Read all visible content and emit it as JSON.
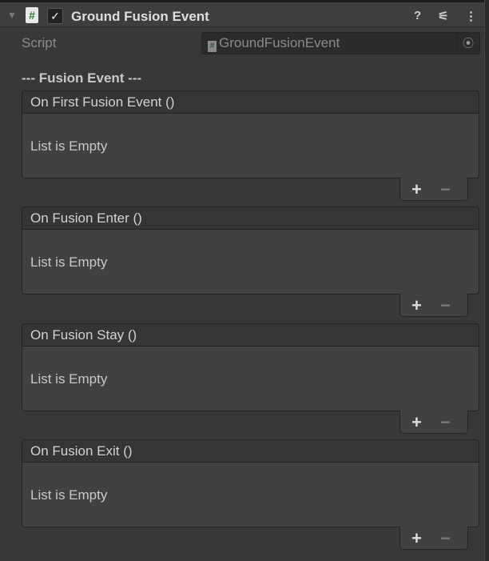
{
  "component": {
    "title": "Ground Fusion Event",
    "enabled": true,
    "icons": [
      "foldout-arrow-icon",
      "script-icon",
      "help-icon",
      "presets-icon",
      "more-icon"
    ]
  },
  "script": {
    "label": "Script",
    "value": "GroundFusionEvent"
  },
  "section_header": "--- Fusion Event ---",
  "events": [
    {
      "name": "On First Fusion Event ()",
      "empty_text": "List is Empty"
    },
    {
      "name": "On Fusion Enter ()",
      "empty_text": "List is Empty"
    },
    {
      "name": "On Fusion Stay ()",
      "empty_text": "List is Empty"
    },
    {
      "name": "On Fusion Exit ()",
      "empty_text": "List is Empty"
    }
  ],
  "buttons": {
    "add": "+",
    "remove": "−"
  }
}
